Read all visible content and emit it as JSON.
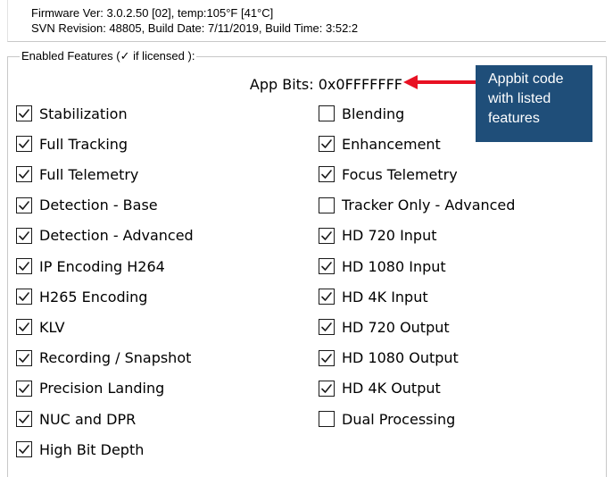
{
  "header": {
    "firmware_line": "Firmware Ver: 3.0.2.50 [02], temp:105°F [41°C]",
    "svn_line": "SVN Revision: 48805, Build Date: 7/11/2019, Build Time: 3:52:2"
  },
  "features_group": {
    "legend": "Enabled Features (✓ if licensed ):",
    "app_bits": "App Bits: 0x0FFFFFFF"
  },
  "callout": {
    "lines": [
      "Appbit code",
      "with listed",
      "features"
    ],
    "background": "#1f4e79",
    "arrow_color": "#e81123"
  },
  "features_left": [
    {
      "label": "Stabilization",
      "checked": true
    },
    {
      "label": "Full Tracking",
      "checked": true
    },
    {
      "label": "Full Telemetry",
      "checked": true
    },
    {
      "label": "Detection - Base",
      "checked": true
    },
    {
      "label": "Detection - Advanced",
      "checked": true
    },
    {
      "label": "IP Encoding H264",
      "checked": true
    },
    {
      "label": "H265 Encoding",
      "checked": true
    },
    {
      "label": "KLV",
      "checked": true
    },
    {
      "label": "Recording / Snapshot",
      "checked": true
    },
    {
      "label": "Precision Landing",
      "checked": true
    },
    {
      "label": "NUC and DPR",
      "checked": true
    },
    {
      "label": "High Bit Depth",
      "checked": true
    }
  ],
  "features_right": [
    {
      "label": "Blending",
      "checked": false
    },
    {
      "label": "Enhancement",
      "checked": true
    },
    {
      "label": "Focus Telemetry",
      "checked": true
    },
    {
      "label": "Tracker Only - Advanced",
      "checked": false
    },
    {
      "label": "HD 720 Input",
      "checked": true
    },
    {
      "label": "HD 1080 Input",
      "checked": true
    },
    {
      "label": "HD 4K Input",
      "checked": true
    },
    {
      "label": "HD 720 Output",
      "checked": true
    },
    {
      "label": "HD 1080 Output",
      "checked": true
    },
    {
      "label": "HD 4K Output",
      "checked": true
    },
    {
      "label": "Dual Processing",
      "checked": false
    }
  ]
}
